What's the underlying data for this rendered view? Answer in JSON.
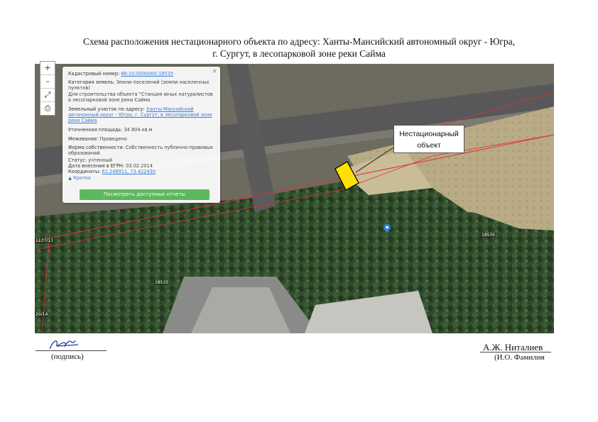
{
  "title": {
    "line1": "Схема расположения нестационарного объекта по адресу: Ханты-Мансийский автономный округ - Югра,",
    "line2": "г. Сургут, в лесопарковой зоне реки Сайма"
  },
  "map_controls": {
    "zoom_in": "+",
    "zoom_out": "–",
    "fullscreen_icon": "expand-icon",
    "print_icon": "printer-icon"
  },
  "popup": {
    "cadastral_label": "Кадастровый номер:",
    "cadastral_value": "86:10:0000000:18535",
    "category_label": "Категория земель:",
    "category_value": "Земли поселений (земли населенных пунктов)",
    "purpose": "Для строительства объекта \"Станция юных натуралистов в лесопарковой зоне реки Сайма",
    "address_label": "Земельный участок по адресу:",
    "address_value": "Ханты-Мансийский автономный округ - Югра, г. Сургут, в лесопарковой зоне реки Сайма",
    "area_label": "Уточненная площадь:",
    "area_value": "34 804 кв.м",
    "owner_label": "Межевание:",
    "owner_value": "Проведено",
    "form_label": "Форма собственности:",
    "form_value": "Собственность публично-правовых образований",
    "status_label": "Статус:",
    "status_value": "учтенный",
    "date_label": "Дата внесения в ЕГРН:",
    "date_value": "03.02.2014",
    "coords_label": "Координаты:",
    "coords_value": "61.248911, 73.422430",
    "collapse": "▲ Кратко",
    "button": "Посмотреть доступные отчеты",
    "close": "×"
  },
  "callout": {
    "line1": "Нестационарный",
    "line2": "объект"
  },
  "map_labels": {
    "parcel1": "18535",
    "parcel2": "18535",
    "parcel3": "1137/13",
    "parcel4": "20/14"
  },
  "signature": {
    "caption": "(подпись)",
    "name": "А.Ж. Ниталиев",
    "name_caption": "(И.О. Фамилия"
  },
  "colors": {
    "boundary": "#e03030",
    "object_fill": "#ffe000",
    "button": "#5cb85c",
    "pin": "#2f7fd8"
  }
}
